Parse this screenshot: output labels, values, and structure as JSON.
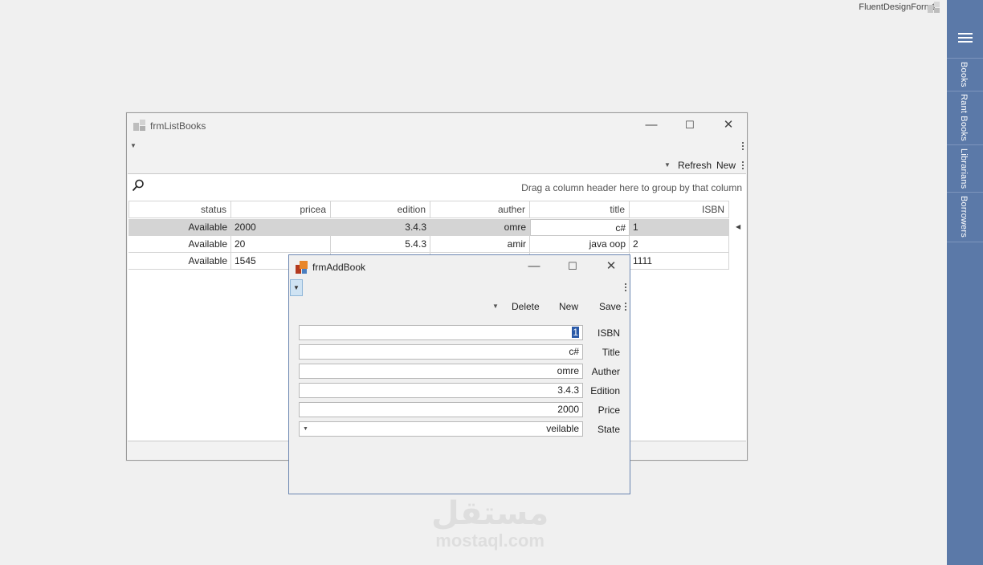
{
  "app": {
    "title": "FluentDesignForm1"
  },
  "sidebar": {
    "items": [
      {
        "label": "Books"
      },
      {
        "label": "Rant Books"
      },
      {
        "label": "Librarians"
      },
      {
        "label": "Borrowers"
      }
    ]
  },
  "list_window": {
    "title": "frmListBooks",
    "toolbar": {
      "refresh_label": "Refresh",
      "new_label": "New"
    },
    "group_hint": "Drag a column header here to group by that column",
    "columns": [
      "status",
      "pricea",
      "edition",
      "auther",
      "title",
      "ISBN"
    ],
    "rows": [
      {
        "status": "Available",
        "price": "2000",
        "edition": "3.4.3",
        "auther": "omre",
        "title": "c#",
        "isbn": "1"
      },
      {
        "status": "Available",
        "price": "20",
        "edition": "5.4.3",
        "auther": "amir",
        "title": "java oop",
        "isbn": "2"
      },
      {
        "status": "Available",
        "price": "1545",
        "edition": "",
        "auther": "",
        "title": "",
        "isbn": "1111"
      }
    ]
  },
  "add_window": {
    "title": "frmAddBook",
    "toolbar": {
      "delete_label": "Delete",
      "new_label": "New",
      "save_label": "Save"
    },
    "fields": [
      {
        "label": "ISBN",
        "value": "1"
      },
      {
        "label": "Title",
        "value": "c#"
      },
      {
        "label": "Auther",
        "value": "omre"
      },
      {
        "label": "Edition",
        "value": "3.4.3"
      },
      {
        "label": "Price",
        "value": "2000"
      },
      {
        "label": "State",
        "value": "veilable"
      }
    ]
  },
  "watermark": {
    "arabic": "مستقل",
    "latin": "mostaql.com"
  },
  "colors": {
    "sidebar": "#5b79a8",
    "dialog_border": "#6a85b0",
    "selected_row": "#d4d4d4",
    "logo_orange": "#e8862a"
  }
}
